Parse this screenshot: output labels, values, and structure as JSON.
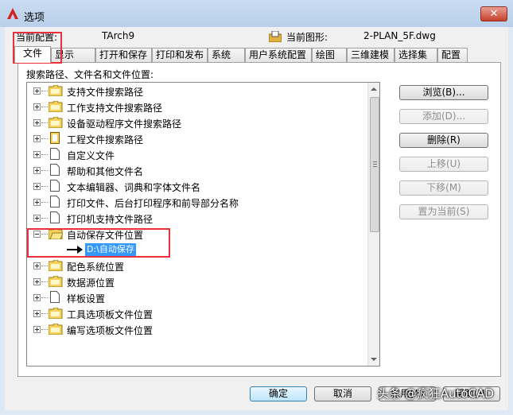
{
  "window": {
    "title": "选项",
    "close_label": "✕"
  },
  "profile": {
    "current_profile_label": "当前配置:",
    "current_profile_value": "TArch9",
    "current_drawing_label": "当前图形:",
    "current_drawing_value": "2-PLAN_5F.dwg"
  },
  "tabs": [
    {
      "label": "文件",
      "active": true
    },
    {
      "label": "显示"
    },
    {
      "label": "打开和保存"
    },
    {
      "label": "打印和发布"
    },
    {
      "label": "系统"
    },
    {
      "label": "用户系统配置"
    },
    {
      "label": "绘图"
    },
    {
      "label": "三维建模"
    },
    {
      "label": "选择集"
    },
    {
      "label": "配置"
    }
  ],
  "files": {
    "section_label": "搜索路径、文件名和文件位置:",
    "tree": [
      {
        "label": "支持文件搜索路径",
        "icon": "folder-icon"
      },
      {
        "label": "工作支持文件搜索路径",
        "icon": "folder-icon"
      },
      {
        "label": "设备驱动程序文件搜索路径",
        "icon": "folder-icon"
      },
      {
        "label": "工程文件搜索路径",
        "icon": "project-icon"
      },
      {
        "label": "自定义文件",
        "icon": "file-icon"
      },
      {
        "label": "帮助和其他文件名",
        "icon": "file-icon"
      },
      {
        "label": "文本编辑器、词典和字体文件名",
        "icon": "file-icon"
      },
      {
        "label": "打印文件、后台打印程序和前导部分名称",
        "icon": "file-icon"
      },
      {
        "label": "打印机支持文件路径",
        "icon": "file-icon"
      },
      {
        "label": "自动保存文件位置",
        "icon": "folder-icon",
        "expanded": true
      },
      {
        "label": "D:\\自动保存",
        "icon": "arrow-icon",
        "selected": true
      },
      {
        "label": "配色系统位置",
        "icon": "folder-icon"
      },
      {
        "label": "数据源位置",
        "icon": "folder-icon"
      },
      {
        "label": "样板设置",
        "icon": "file-icon"
      },
      {
        "label": "工具选项板文件位置",
        "icon": "folder-icon"
      },
      {
        "label": "编写选项板文件位置",
        "icon": "folder-icon"
      }
    ],
    "buttons": {
      "browse": "浏览(B)...",
      "add": "添加(D)...",
      "remove": "删除(R)",
      "move_up": "上移(U)",
      "move_down": "下移(M)",
      "set_current": "置为当前(S)"
    }
  },
  "dialog_buttons": {
    "ok": "确定",
    "cancel": "取消",
    "apply": "应用(A)",
    "help": "帮助(H)"
  },
  "watermark": "头条 @疯狂AutoCAD",
  "colors": {
    "highlight_box": "#e8313a",
    "selection": "#3399ff",
    "window_frame": "#dfe9f5"
  }
}
